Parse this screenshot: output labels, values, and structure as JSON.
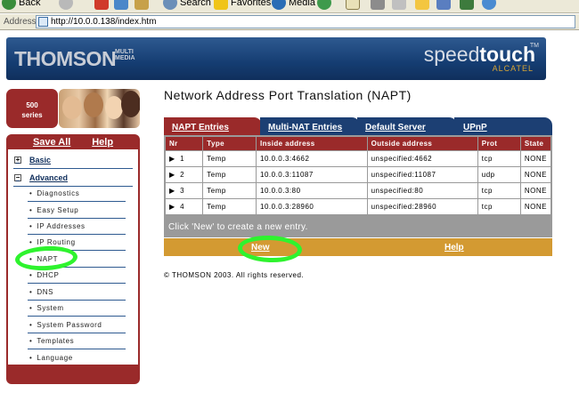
{
  "browser": {
    "toolbar": {
      "back": "Back",
      "search": "Search",
      "favorites": "Favorites",
      "media": "Media"
    },
    "address_label": "Address",
    "url": "http://10.0.0.138/index.htm"
  },
  "banner": {
    "brand": "THOMSON",
    "brand_sub": "MULTI MEDIA",
    "product_light": "speed",
    "product_bold": "touch",
    "trademark": "TM",
    "partner": "ALCATEL"
  },
  "series_badge": {
    "number": "500",
    "label": "series"
  },
  "sidebar": {
    "save_all": "Save All",
    "help": "Help",
    "groups": [
      {
        "label": "Basic",
        "toggle": "+"
      },
      {
        "label": "Advanced",
        "toggle": "−"
      }
    ],
    "items": [
      "Diagnostics",
      "Easy Setup",
      "IP Addresses",
      "IP Routing",
      "NAPT",
      "DHCP",
      "DNS",
      "System",
      "System Password",
      "Templates",
      "Language"
    ]
  },
  "main": {
    "title": "Network Address Port Translation (NAPT)",
    "tabs": [
      "NAPT Entries",
      "Multi-NAT Entries",
      "Default Server",
      "UPnP"
    ],
    "active_tab": "NAPT Entries",
    "columns": [
      "Nr",
      "Type",
      "Inside address",
      "Outside address",
      "Prot",
      "State"
    ],
    "rows": [
      {
        "nr": "1",
        "type": "Temp",
        "inside": "10.0.0.3:4662",
        "outside": "unspecified:4662",
        "prot": "tcp",
        "state": "NONE"
      },
      {
        "nr": "2",
        "type": "Temp",
        "inside": "10.0.0.3:11087",
        "outside": "unspecified:11087",
        "prot": "udp",
        "state": "NONE"
      },
      {
        "nr": "3",
        "type": "Temp",
        "inside": "10.0.0.3:80",
        "outside": "unspecified:80",
        "prot": "tcp",
        "state": "NONE"
      },
      {
        "nr": "4",
        "type": "Temp",
        "inside": "10.0.0.3:28960",
        "outside": "unspecified:28960",
        "prot": "tcp",
        "state": "NONE"
      }
    ],
    "hint": "Click 'New' to create a new entry.",
    "new_label": "New",
    "help_label": "Help",
    "copyright": "© THOMSON 2003. All rights reserved."
  },
  "colors": {
    "maroon": "#9a2a2a",
    "navy": "#1c3f73",
    "gold": "#d39a32",
    "highlight": "#2ef32e"
  }
}
